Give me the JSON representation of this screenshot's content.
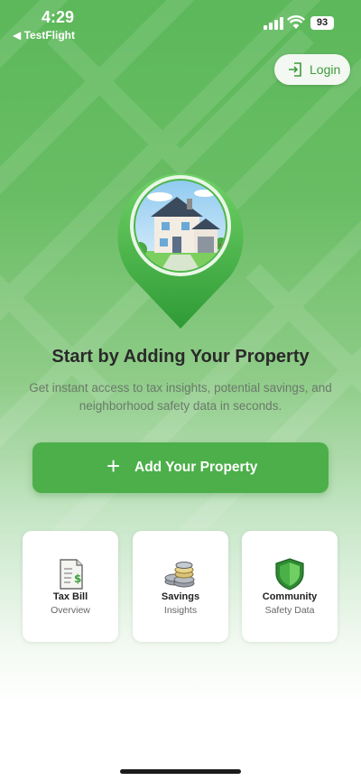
{
  "status_bar": {
    "time": "4:29",
    "back_app": "◀ TestFlight",
    "battery": "93"
  },
  "header": {
    "login_label": "Login"
  },
  "hero": {
    "title": "Start by Adding Your Property",
    "subtitle": "Get instant access to tax insights, potential savings, and neighborhood safety data in seconds."
  },
  "primary_action": {
    "icon": "plus-icon",
    "label": "Add Your Property"
  },
  "features": [
    {
      "icon": "tax-document-icon",
      "title": "Tax Bill",
      "subtitle": "Overview"
    },
    {
      "icon": "coins-icon",
      "title": "Savings",
      "subtitle": "Insights"
    },
    {
      "icon": "shield-icon",
      "title": "Community",
      "subtitle": "Safety Data"
    }
  ],
  "colors": {
    "brand_green": "#4caf4a",
    "background_green": "#5cb85a",
    "login_text": "#3e9a3b"
  }
}
